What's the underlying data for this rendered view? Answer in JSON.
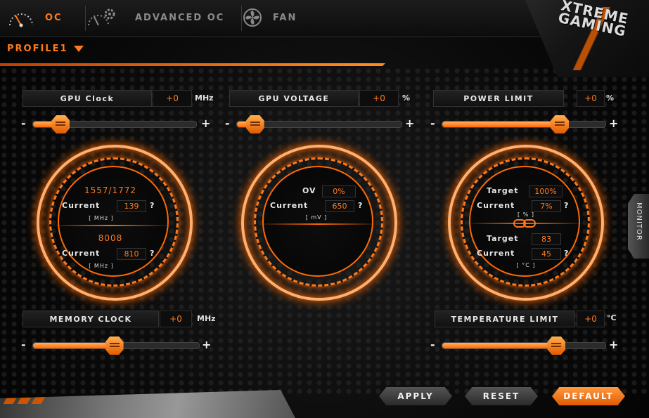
{
  "tabs": [
    {
      "label": "OC",
      "active": true,
      "icon": "speedometer-icon"
    },
    {
      "label": "ADVANCED OC",
      "active": false,
      "icon": "gauge-gear-icon"
    },
    {
      "label": "FAN",
      "active": false,
      "icon": "fan-icon"
    }
  ],
  "logo": {
    "line1": "XTREME",
    "line2": "GAMING"
  },
  "profile": {
    "label": "PROFILE1"
  },
  "controls": {
    "gpu_clock": {
      "label": "GPU Clock",
      "value": "+0",
      "unit": "MHz",
      "level": 0.17
    },
    "gpu_voltage": {
      "label": "GPU VOLTAGE",
      "value": "+0",
      "unit": "%",
      "level": 0.11
    },
    "power_limit": {
      "label": "POWER LIMIT",
      "value": "+0",
      "unit": "%",
      "level": 0.72
    },
    "memory_clock": {
      "label": "MEMORY CLOCK",
      "value": "+0",
      "unit": "MHz",
      "level": 0.49
    },
    "temperature_limit": {
      "label": "TEMPERATURE LIMIT",
      "value": "+0",
      "unit": "°C",
      "level": 0.7
    }
  },
  "minus": "-",
  "plus": "+",
  "question": "?",
  "rings": {
    "clock": {
      "core_clock": "1557/1772",
      "current_label": "Current",
      "core_current": "139",
      "core_unit": "[ MHz ]",
      "mem_clock": "8008",
      "mem_current": "810",
      "mem_unit": "[ MHz ]"
    },
    "voltage": {
      "ov_label": "OV",
      "ov_value": "0%",
      "current_label": "Current",
      "current_value": "650",
      "unit": "[ mV ]"
    },
    "power": {
      "target_label": "Target",
      "target_value": "100%",
      "current_label": "Current",
      "current_value": "7%",
      "unit": "[ % ]",
      "temp_target_label": "Target",
      "temp_target_value": "83",
      "temp_current_label": "Current",
      "temp_current_value": "45",
      "temp_unit": "[ °C ]"
    }
  },
  "monitor": {
    "label": "MONITOR"
  },
  "buttons": {
    "apply": "APPLY",
    "reset": "RESET",
    "default": "DEFAULT"
  }
}
